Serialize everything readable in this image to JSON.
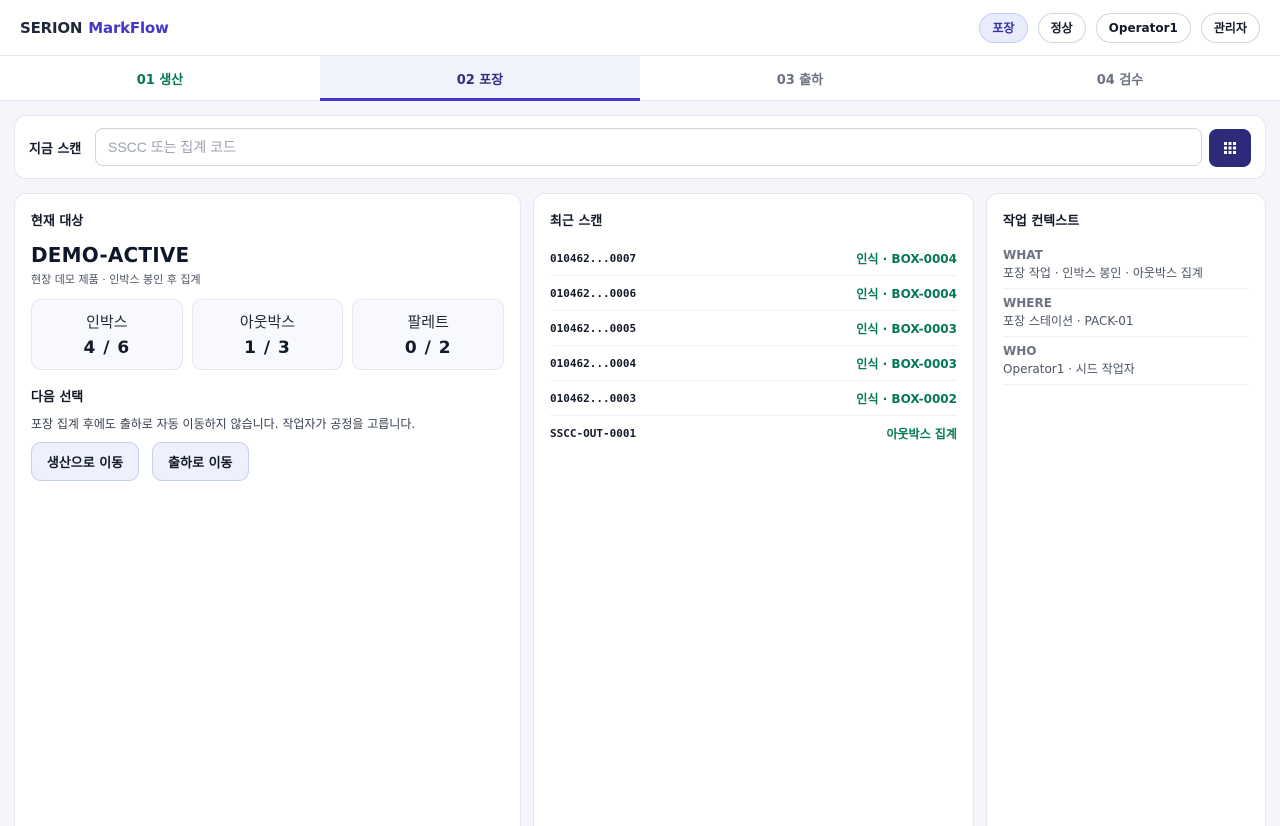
{
  "header": {
    "brand_main": "SERION",
    "brand_accent": "MarkFlow",
    "pills": {
      "stage": "포장",
      "status": "정상",
      "operator": "Operator1",
      "admin": "관리자"
    }
  },
  "tabs": [
    {
      "label": "01 생산",
      "state": "done"
    },
    {
      "label": "02 포장",
      "state": "current"
    },
    {
      "label": "03 출하",
      "state": "pending"
    },
    {
      "label": "04 검수",
      "state": "pending"
    }
  ],
  "scan": {
    "label": "지금 스캔",
    "placeholder": "SSCC 또는 집계 코드",
    "button_icon": "grid-icon"
  },
  "current_target": {
    "title": "현재 대상",
    "name": "DEMO-ACTIVE",
    "description": "현장 데모 제품 · 인박스 봉인 후 집계",
    "counters": [
      {
        "label": "인박스",
        "value": "4 / 6"
      },
      {
        "label": "아웃박스",
        "value": "1 / 3"
      },
      {
        "label": "팔레트",
        "value": "0 / 2"
      }
    ],
    "next": {
      "title": "다음 선택",
      "description": "포장 집계 후에도 출하로 자동 이동하지 않습니다. 작업자가 공정을 고릅니다.",
      "buttons": [
        "생산으로 이동",
        "출하로 이동"
      ]
    }
  },
  "recent_scans": {
    "title": "최근 스캔",
    "rows": [
      {
        "code": "010462...0007",
        "status": "인식 · BOX-0004"
      },
      {
        "code": "010462...0006",
        "status": "인식 · BOX-0004"
      },
      {
        "code": "010462...0005",
        "status": "인식 · BOX-0003"
      },
      {
        "code": "010462...0004",
        "status": "인식 · BOX-0003"
      },
      {
        "code": "010462...0003",
        "status": "인식 · BOX-0002"
      },
      {
        "code": "SSCC-OUT-0001",
        "status": "아웃박스 집계"
      }
    ]
  },
  "context": {
    "title": "작업 컨텍스트",
    "items": [
      {
        "key": "WHAT",
        "value": "포장 작업 · 인박스 봉인 · 아웃박스 집계"
      },
      {
        "key": "WHERE",
        "value": "포장 스테이션 · PACK-01"
      },
      {
        "key": "WHO",
        "value": "Operator1 · 시드 작업자"
      }
    ]
  },
  "colors": {
    "accent": "#4338ca",
    "success": "#047857",
    "scan_button": "#2e2a7a"
  }
}
